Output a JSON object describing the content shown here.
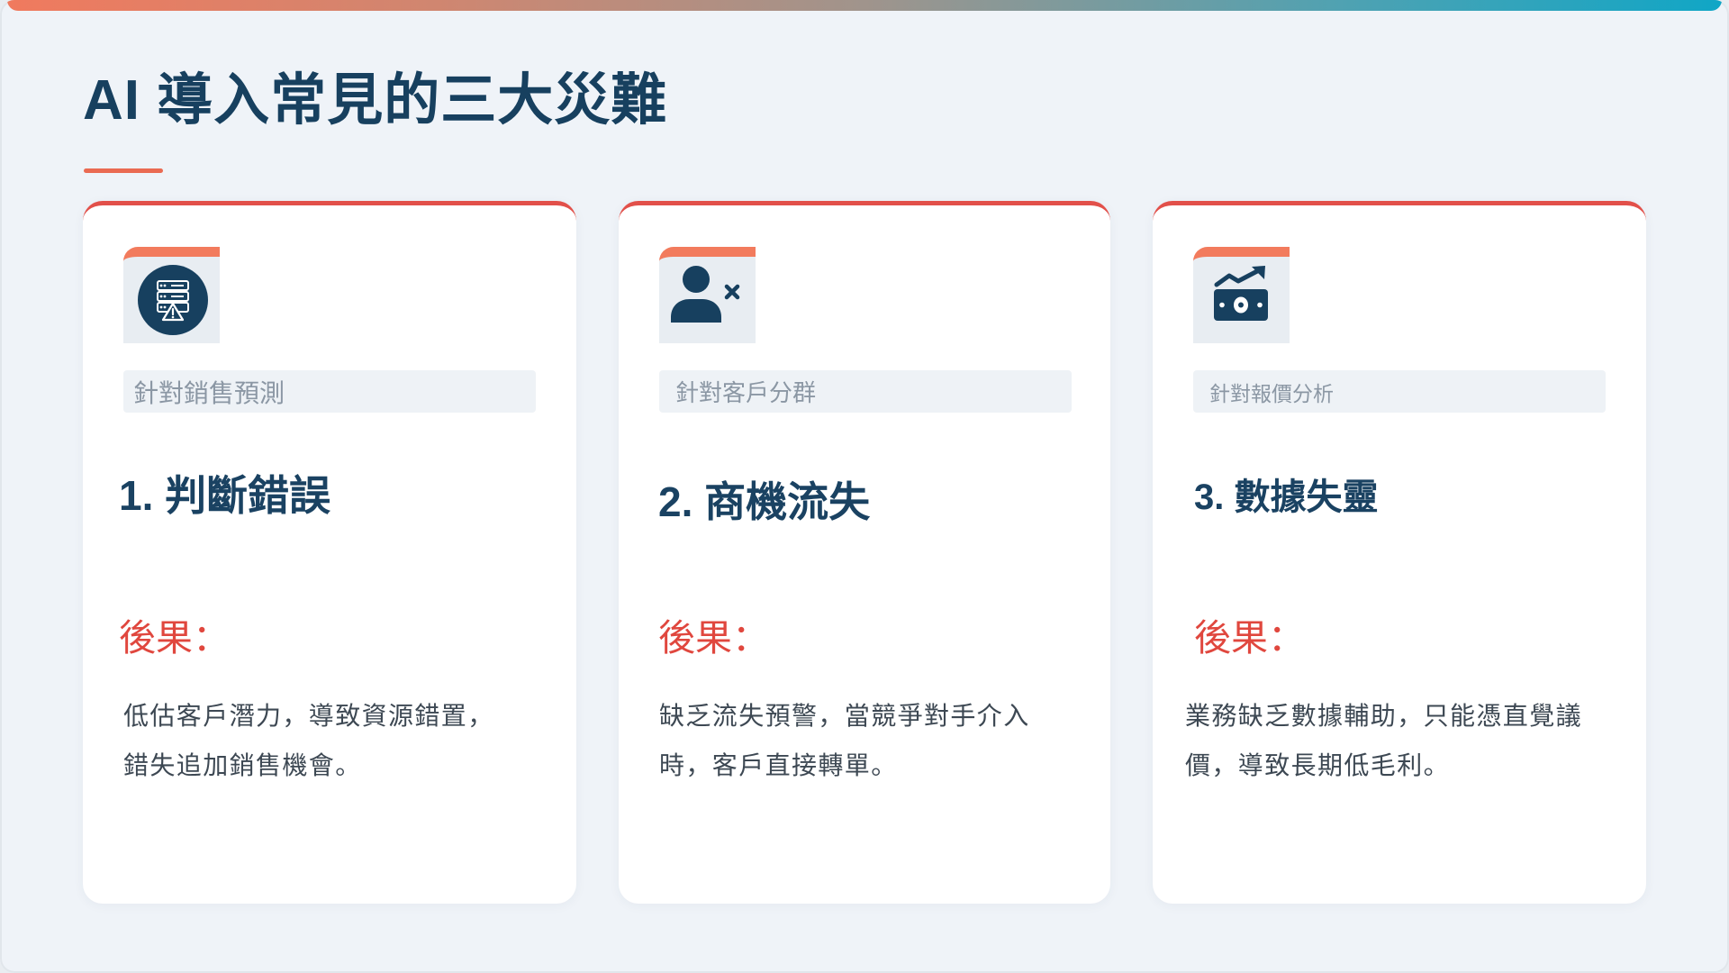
{
  "slide": {
    "title": "AI 導入常見的三大災難"
  },
  "colors": {
    "background": "#eff3f8",
    "title_navy": "#17405f",
    "accent_red": "#e0473e",
    "card_top_border": "#e2504a",
    "icon_tab_coral": "#f27b5d",
    "top_bar_gradient_start": "#f07a5e",
    "top_bar_gradient_end": "#10a6c6"
  },
  "cards": [
    {
      "icon": "server-warning-icon",
      "tag": "針對銷售預測",
      "heading": "1. 判斷錯誤",
      "consequence_label": "後果：",
      "consequence_lines": [
        "低估客戶潛力，導致資源錯置，",
        "錯失追加銷售機會。"
      ]
    },
    {
      "icon": "user-remove-icon",
      "tag": "針對客戶分群",
      "heading": "2. 商機流失",
      "consequence_label": "後果：",
      "consequence_lines": [
        "缺乏流失預警，當競爭對手介入",
        "時，客戶直接轉單。"
      ]
    },
    {
      "icon": "money-trend-icon",
      "tag": "針對報價分析",
      "heading": "3. 數據失靈",
      "consequence_label": "後果：",
      "consequence_lines": [
        "業務缺乏數據輔助，只能憑直覺議",
        "價，導致長期低毛利。"
      ]
    }
  ]
}
